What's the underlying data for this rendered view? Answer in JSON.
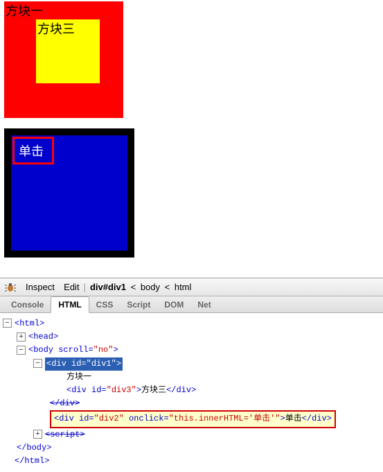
{
  "boxes": {
    "box1_label": "方块一",
    "box3_label": "方块三",
    "box2_label": "单击"
  },
  "toolbar": {
    "inspect": "Inspect",
    "edit": "Edit",
    "crumb_bold": "div#div1",
    "crumb_body": "body",
    "crumb_html": "html"
  },
  "tabs": {
    "console": "Console",
    "html": "HTML",
    "css": "CSS",
    "script": "Script",
    "dom": "DOM",
    "net": "Net"
  },
  "src": {
    "html_open": "<html>",
    "head": "<head>",
    "body_open": "<body ",
    "body_attr_name": "scroll",
    "body_attr_val": "\"no\"",
    "body_close": ">",
    "div1_open": "<div ",
    "div1_attr_name": "id",
    "div1_attr_val": "\"div1\"",
    "div1_close": ">",
    "div1_text": "方块一",
    "div3_open": "<div ",
    "div3_attr_name": "id",
    "div3_attr_val": "\"div3\"",
    "div3_mid": ">",
    "div3_text": "方块三",
    "div3_end": "</div>",
    "div1_end": "</div>",
    "div2_open": "<div ",
    "div2_id_name": "id",
    "div2_id_val": "\"div2\"",
    "div2_onclick_name": "onclick",
    "div2_onclick_val": "\"this.innerHTML='单击'\"",
    "div2_mid": ">",
    "div2_text": "单击",
    "div2_end": "</div>",
    "script_tag": "<script>",
    "body_end": "</body>",
    "html_end": "</html>"
  }
}
